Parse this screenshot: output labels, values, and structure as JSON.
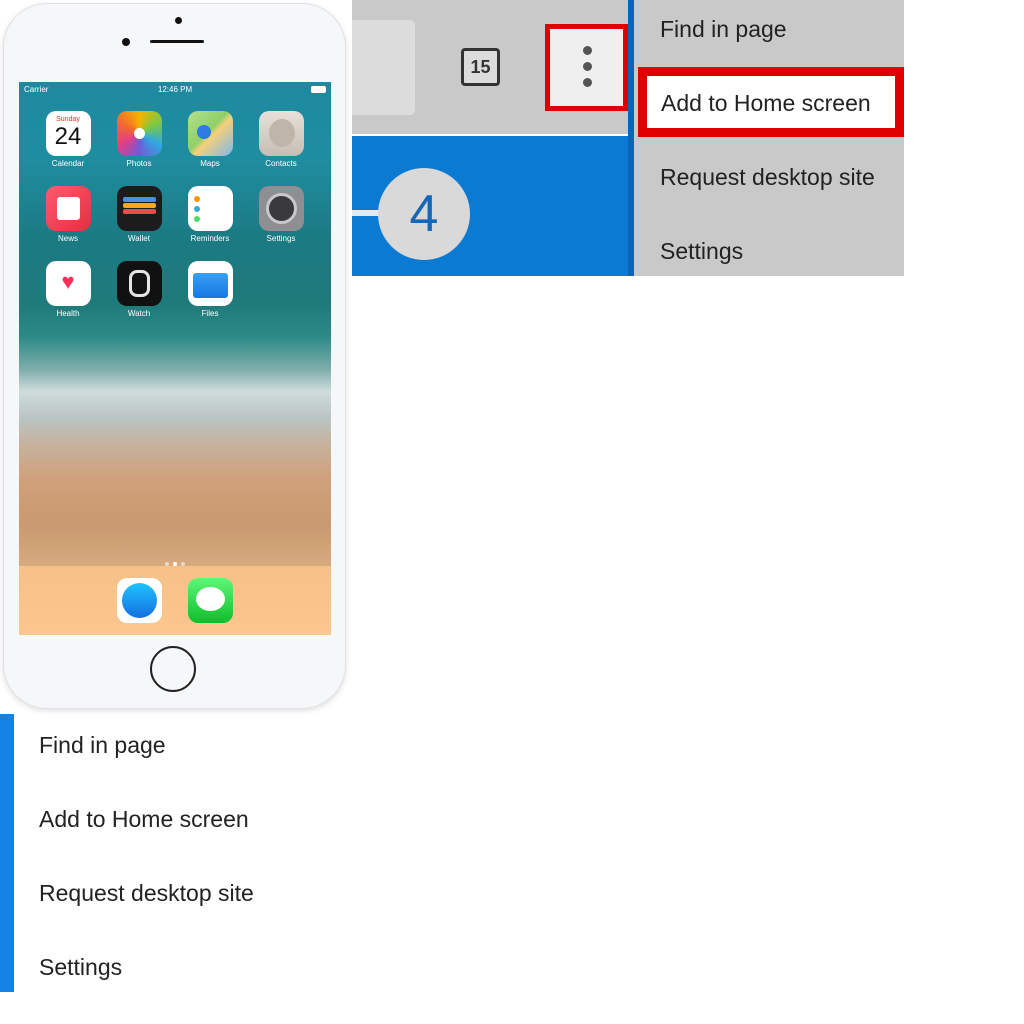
{
  "phone": {
    "status_bar": {
      "carrier": "Carrier",
      "time": "12:46 PM"
    },
    "apps": [
      {
        "label": "Calendar",
        "day": "Sunday",
        "date": "24",
        "icon": "calendar-icon"
      },
      {
        "label": "Photos",
        "icon": "photos-icon"
      },
      {
        "label": "Maps",
        "icon": "maps-icon"
      },
      {
        "label": "Contacts",
        "icon": "contacts-icon"
      },
      {
        "label": "News",
        "icon": "news-icon"
      },
      {
        "label": "Wallet",
        "icon": "wallet-icon"
      },
      {
        "label": "Reminders",
        "icon": "reminders-icon"
      },
      {
        "label": "Settings",
        "icon": "settings-icon"
      },
      {
        "label": "Health",
        "icon": "health-icon"
      },
      {
        "label": "Watch",
        "icon": "watch-icon"
      },
      {
        "label": "Files",
        "icon": "files-icon"
      }
    ],
    "dock": [
      {
        "icon": "safari-icon"
      },
      {
        "icon": "messages-icon"
      }
    ],
    "page_dots": {
      "count": 3,
      "active_index": 1
    }
  },
  "toolbar": {
    "tab_count": "15",
    "menu_icon": "three-dot-menu-icon",
    "step_callout": "4"
  },
  "menu_top": {
    "items": [
      "Find in page",
      "Add to Home screen",
      "Request desktop site",
      "Settings"
    ],
    "highlighted_item": "Add to Home screen"
  },
  "menu_bottom": {
    "items": [
      "Find in page",
      "Add to Home screen",
      "Request desktop site",
      "Settings"
    ]
  },
  "colors": {
    "highlight_red": "#e00000",
    "accent_blue": "#0a7ad2",
    "toolbar_gray": "#c9c9c9"
  }
}
